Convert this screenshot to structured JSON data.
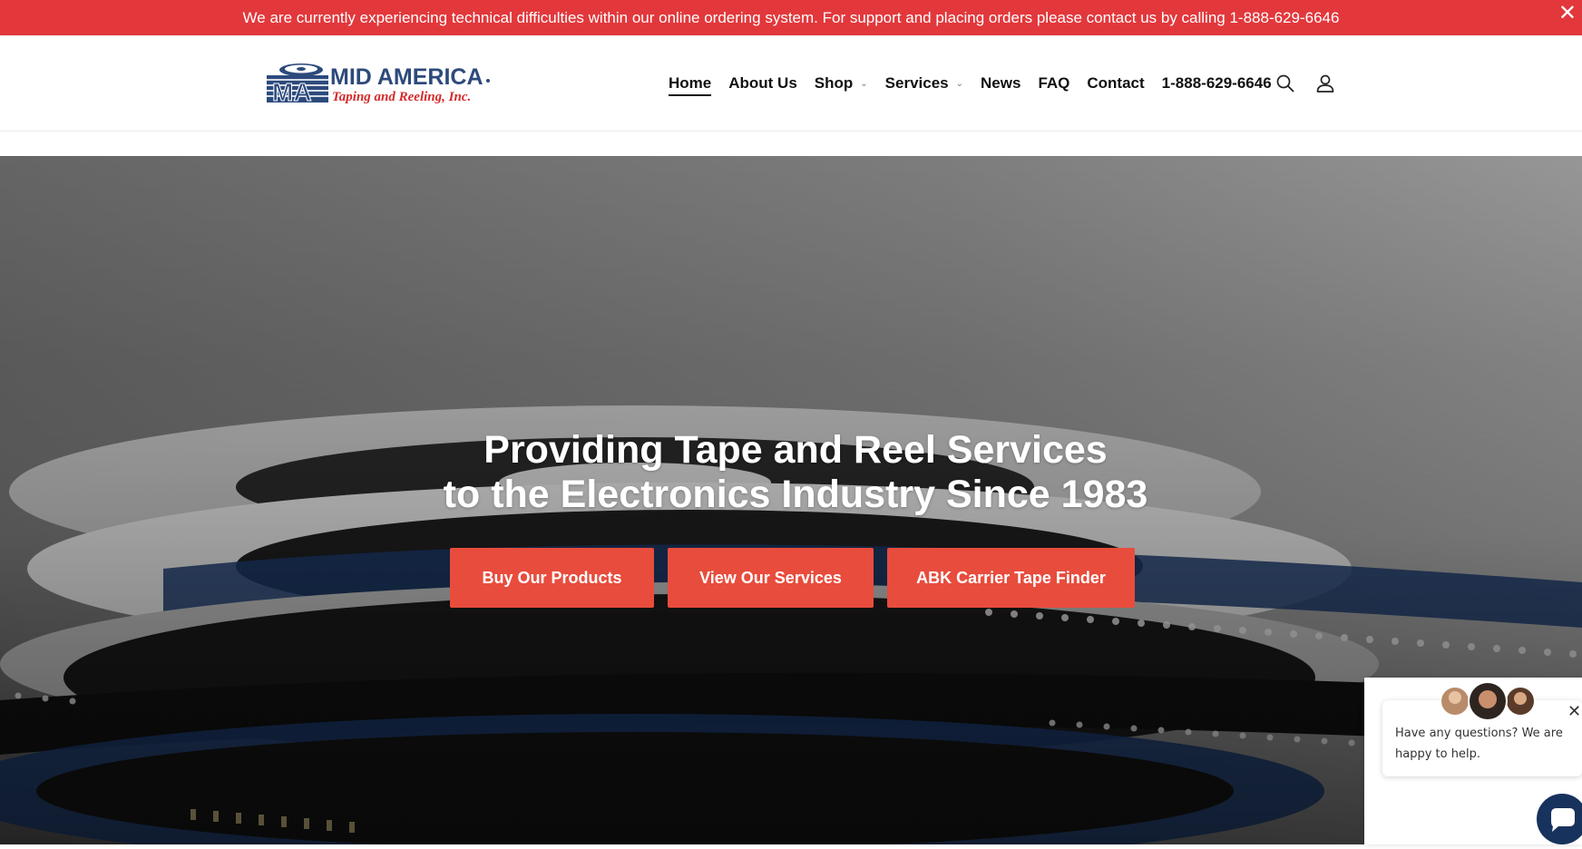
{
  "announcement": {
    "text": "We are currently experiencing technical difficulties within our online ordering system. For support and placing orders please contact us by calling 1-888-629-6646",
    "close_glyph": "✕"
  },
  "logo": {
    "line1": "MID AMERICA",
    "line2": "Taping and Reeling, Inc.",
    "mark": "MA"
  },
  "nav": {
    "items": [
      {
        "label": "Home",
        "active": true
      },
      {
        "label": "About Us"
      },
      {
        "label": "Shop",
        "dropdown": true
      },
      {
        "label": "Services",
        "dropdown": true
      },
      {
        "label": "News"
      },
      {
        "label": "FAQ"
      },
      {
        "label": "Contact"
      },
      {
        "label": "1-888-629-6646"
      }
    ],
    "chevron": "⌄",
    "icons": [
      "search-icon",
      "account-icon"
    ]
  },
  "hero": {
    "title_line1": "Providing Tape and Reel Services",
    "title_line2": "to the Electronics Industry Since 1983",
    "buttons": [
      {
        "label": "Buy Our Products"
      },
      {
        "label": "View Our Services"
      },
      {
        "label": "ABK Carrier Tape Finder"
      }
    ]
  },
  "chat": {
    "message": "Have any questions? We are happy to help.",
    "close_glyph": "✕"
  },
  "colors": {
    "announcement_bg": "#e2383c",
    "button_bg": "#e84c3d",
    "logo_blue": "#2d4a7c",
    "logo_red": "#d42a2a",
    "chat_launcher": "#17325c"
  }
}
